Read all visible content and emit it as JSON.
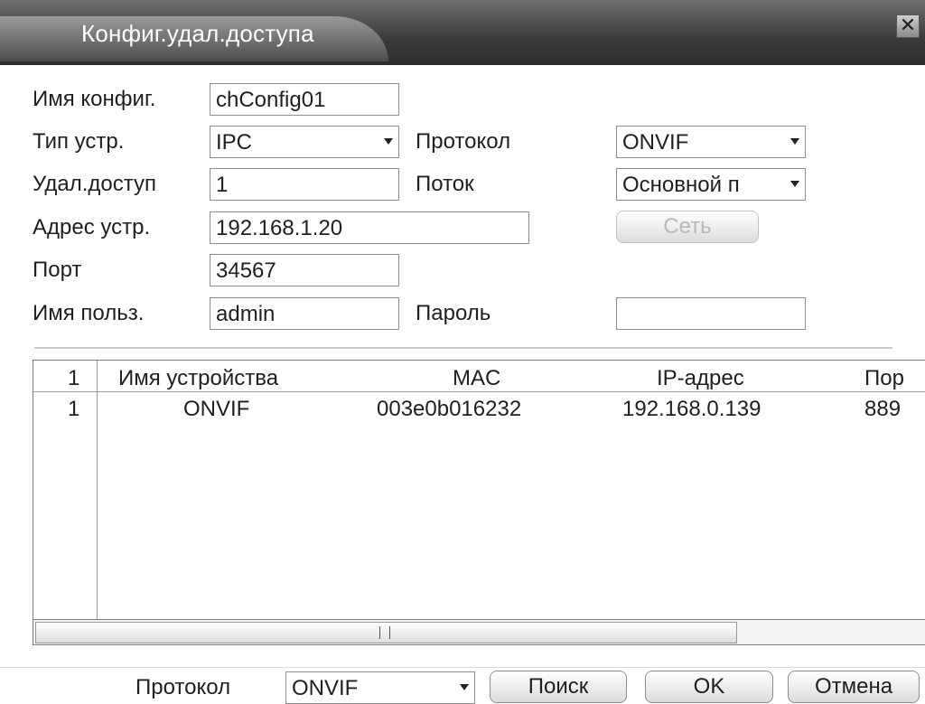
{
  "window": {
    "title": "Конфиг.удал.доступа",
    "close_glyph": "✕"
  },
  "form": {
    "config_name_label": "Имя конфиг.",
    "config_name_value": "chConfig01",
    "device_type_label": "Тип устр.",
    "device_type_value": "IPC",
    "protocol_label": "Протокол",
    "protocol_value": "ONVIF",
    "remote_channel_label": "Удал.доступ",
    "remote_channel_value": "1",
    "stream_label": "Поток",
    "stream_value": "Основной п",
    "device_address_label": "Адрес устр.",
    "device_address_value": "192.168.1.20",
    "network_button": "Сеть",
    "port_label": "Порт",
    "port_value": "34567",
    "username_label": "Имя польз.",
    "username_value": "admin",
    "password_label": "Пароль",
    "password_value": ""
  },
  "device_table": {
    "headers": [
      "1",
      "Имя устройства",
      "MAC",
      "IP-адрес",
      "Пор"
    ],
    "rows": [
      [
        "1",
        "ONVIF",
        "003e0b016232",
        "192.168.0.139",
        "889"
      ]
    ]
  },
  "footer": {
    "protocol_label": "Протокол",
    "protocol_value": "ONVIF",
    "search_button": "Поиск",
    "ok_button": "OK",
    "cancel_button": "Отмена"
  }
}
